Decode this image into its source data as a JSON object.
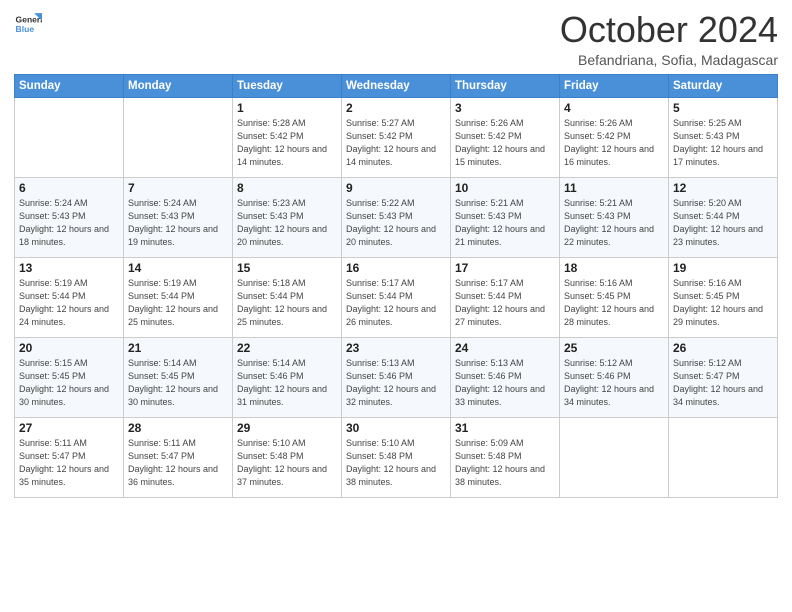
{
  "header": {
    "logo_line1": "General",
    "logo_line2": "Blue",
    "month": "October 2024",
    "location": "Befandriana, Sofia, Madagascar"
  },
  "weekdays": [
    "Sunday",
    "Monday",
    "Tuesday",
    "Wednesday",
    "Thursday",
    "Friday",
    "Saturday"
  ],
  "weeks": [
    [
      {
        "day": "",
        "sunrise": "",
        "sunset": "",
        "daylight": ""
      },
      {
        "day": "",
        "sunrise": "",
        "sunset": "",
        "daylight": ""
      },
      {
        "day": "1",
        "sunrise": "Sunrise: 5:28 AM",
        "sunset": "Sunset: 5:42 PM",
        "daylight": "Daylight: 12 hours and 14 minutes."
      },
      {
        "day": "2",
        "sunrise": "Sunrise: 5:27 AM",
        "sunset": "Sunset: 5:42 PM",
        "daylight": "Daylight: 12 hours and 14 minutes."
      },
      {
        "day": "3",
        "sunrise": "Sunrise: 5:26 AM",
        "sunset": "Sunset: 5:42 PM",
        "daylight": "Daylight: 12 hours and 15 minutes."
      },
      {
        "day": "4",
        "sunrise": "Sunrise: 5:26 AM",
        "sunset": "Sunset: 5:42 PM",
        "daylight": "Daylight: 12 hours and 16 minutes."
      },
      {
        "day": "5",
        "sunrise": "Sunrise: 5:25 AM",
        "sunset": "Sunset: 5:43 PM",
        "daylight": "Daylight: 12 hours and 17 minutes."
      }
    ],
    [
      {
        "day": "6",
        "sunrise": "Sunrise: 5:24 AM",
        "sunset": "Sunset: 5:43 PM",
        "daylight": "Daylight: 12 hours and 18 minutes."
      },
      {
        "day": "7",
        "sunrise": "Sunrise: 5:24 AM",
        "sunset": "Sunset: 5:43 PM",
        "daylight": "Daylight: 12 hours and 19 minutes."
      },
      {
        "day": "8",
        "sunrise": "Sunrise: 5:23 AM",
        "sunset": "Sunset: 5:43 PM",
        "daylight": "Daylight: 12 hours and 20 minutes."
      },
      {
        "day": "9",
        "sunrise": "Sunrise: 5:22 AM",
        "sunset": "Sunset: 5:43 PM",
        "daylight": "Daylight: 12 hours and 20 minutes."
      },
      {
        "day": "10",
        "sunrise": "Sunrise: 5:21 AM",
        "sunset": "Sunset: 5:43 PM",
        "daylight": "Daylight: 12 hours and 21 minutes."
      },
      {
        "day": "11",
        "sunrise": "Sunrise: 5:21 AM",
        "sunset": "Sunset: 5:43 PM",
        "daylight": "Daylight: 12 hours and 22 minutes."
      },
      {
        "day": "12",
        "sunrise": "Sunrise: 5:20 AM",
        "sunset": "Sunset: 5:44 PM",
        "daylight": "Daylight: 12 hours and 23 minutes."
      }
    ],
    [
      {
        "day": "13",
        "sunrise": "Sunrise: 5:19 AM",
        "sunset": "Sunset: 5:44 PM",
        "daylight": "Daylight: 12 hours and 24 minutes."
      },
      {
        "day": "14",
        "sunrise": "Sunrise: 5:19 AM",
        "sunset": "Sunset: 5:44 PM",
        "daylight": "Daylight: 12 hours and 25 minutes."
      },
      {
        "day": "15",
        "sunrise": "Sunrise: 5:18 AM",
        "sunset": "Sunset: 5:44 PM",
        "daylight": "Daylight: 12 hours and 25 minutes."
      },
      {
        "day": "16",
        "sunrise": "Sunrise: 5:17 AM",
        "sunset": "Sunset: 5:44 PM",
        "daylight": "Daylight: 12 hours and 26 minutes."
      },
      {
        "day": "17",
        "sunrise": "Sunrise: 5:17 AM",
        "sunset": "Sunset: 5:44 PM",
        "daylight": "Daylight: 12 hours and 27 minutes."
      },
      {
        "day": "18",
        "sunrise": "Sunrise: 5:16 AM",
        "sunset": "Sunset: 5:45 PM",
        "daylight": "Daylight: 12 hours and 28 minutes."
      },
      {
        "day": "19",
        "sunrise": "Sunrise: 5:16 AM",
        "sunset": "Sunset: 5:45 PM",
        "daylight": "Daylight: 12 hours and 29 minutes."
      }
    ],
    [
      {
        "day": "20",
        "sunrise": "Sunrise: 5:15 AM",
        "sunset": "Sunset: 5:45 PM",
        "daylight": "Daylight: 12 hours and 30 minutes."
      },
      {
        "day": "21",
        "sunrise": "Sunrise: 5:14 AM",
        "sunset": "Sunset: 5:45 PM",
        "daylight": "Daylight: 12 hours and 30 minutes."
      },
      {
        "day": "22",
        "sunrise": "Sunrise: 5:14 AM",
        "sunset": "Sunset: 5:46 PM",
        "daylight": "Daylight: 12 hours and 31 minutes."
      },
      {
        "day": "23",
        "sunrise": "Sunrise: 5:13 AM",
        "sunset": "Sunset: 5:46 PM",
        "daylight": "Daylight: 12 hours and 32 minutes."
      },
      {
        "day": "24",
        "sunrise": "Sunrise: 5:13 AM",
        "sunset": "Sunset: 5:46 PM",
        "daylight": "Daylight: 12 hours and 33 minutes."
      },
      {
        "day": "25",
        "sunrise": "Sunrise: 5:12 AM",
        "sunset": "Sunset: 5:46 PM",
        "daylight": "Daylight: 12 hours and 34 minutes."
      },
      {
        "day": "26",
        "sunrise": "Sunrise: 5:12 AM",
        "sunset": "Sunset: 5:47 PM",
        "daylight": "Daylight: 12 hours and 34 minutes."
      }
    ],
    [
      {
        "day": "27",
        "sunrise": "Sunrise: 5:11 AM",
        "sunset": "Sunset: 5:47 PM",
        "daylight": "Daylight: 12 hours and 35 minutes."
      },
      {
        "day": "28",
        "sunrise": "Sunrise: 5:11 AM",
        "sunset": "Sunset: 5:47 PM",
        "daylight": "Daylight: 12 hours and 36 minutes."
      },
      {
        "day": "29",
        "sunrise": "Sunrise: 5:10 AM",
        "sunset": "Sunset: 5:48 PM",
        "daylight": "Daylight: 12 hours and 37 minutes."
      },
      {
        "day": "30",
        "sunrise": "Sunrise: 5:10 AM",
        "sunset": "Sunset: 5:48 PM",
        "daylight": "Daylight: 12 hours and 38 minutes."
      },
      {
        "day": "31",
        "sunrise": "Sunrise: 5:09 AM",
        "sunset": "Sunset: 5:48 PM",
        "daylight": "Daylight: 12 hours and 38 minutes."
      },
      {
        "day": "",
        "sunrise": "",
        "sunset": "",
        "daylight": ""
      },
      {
        "day": "",
        "sunrise": "",
        "sunset": "",
        "daylight": ""
      }
    ]
  ]
}
